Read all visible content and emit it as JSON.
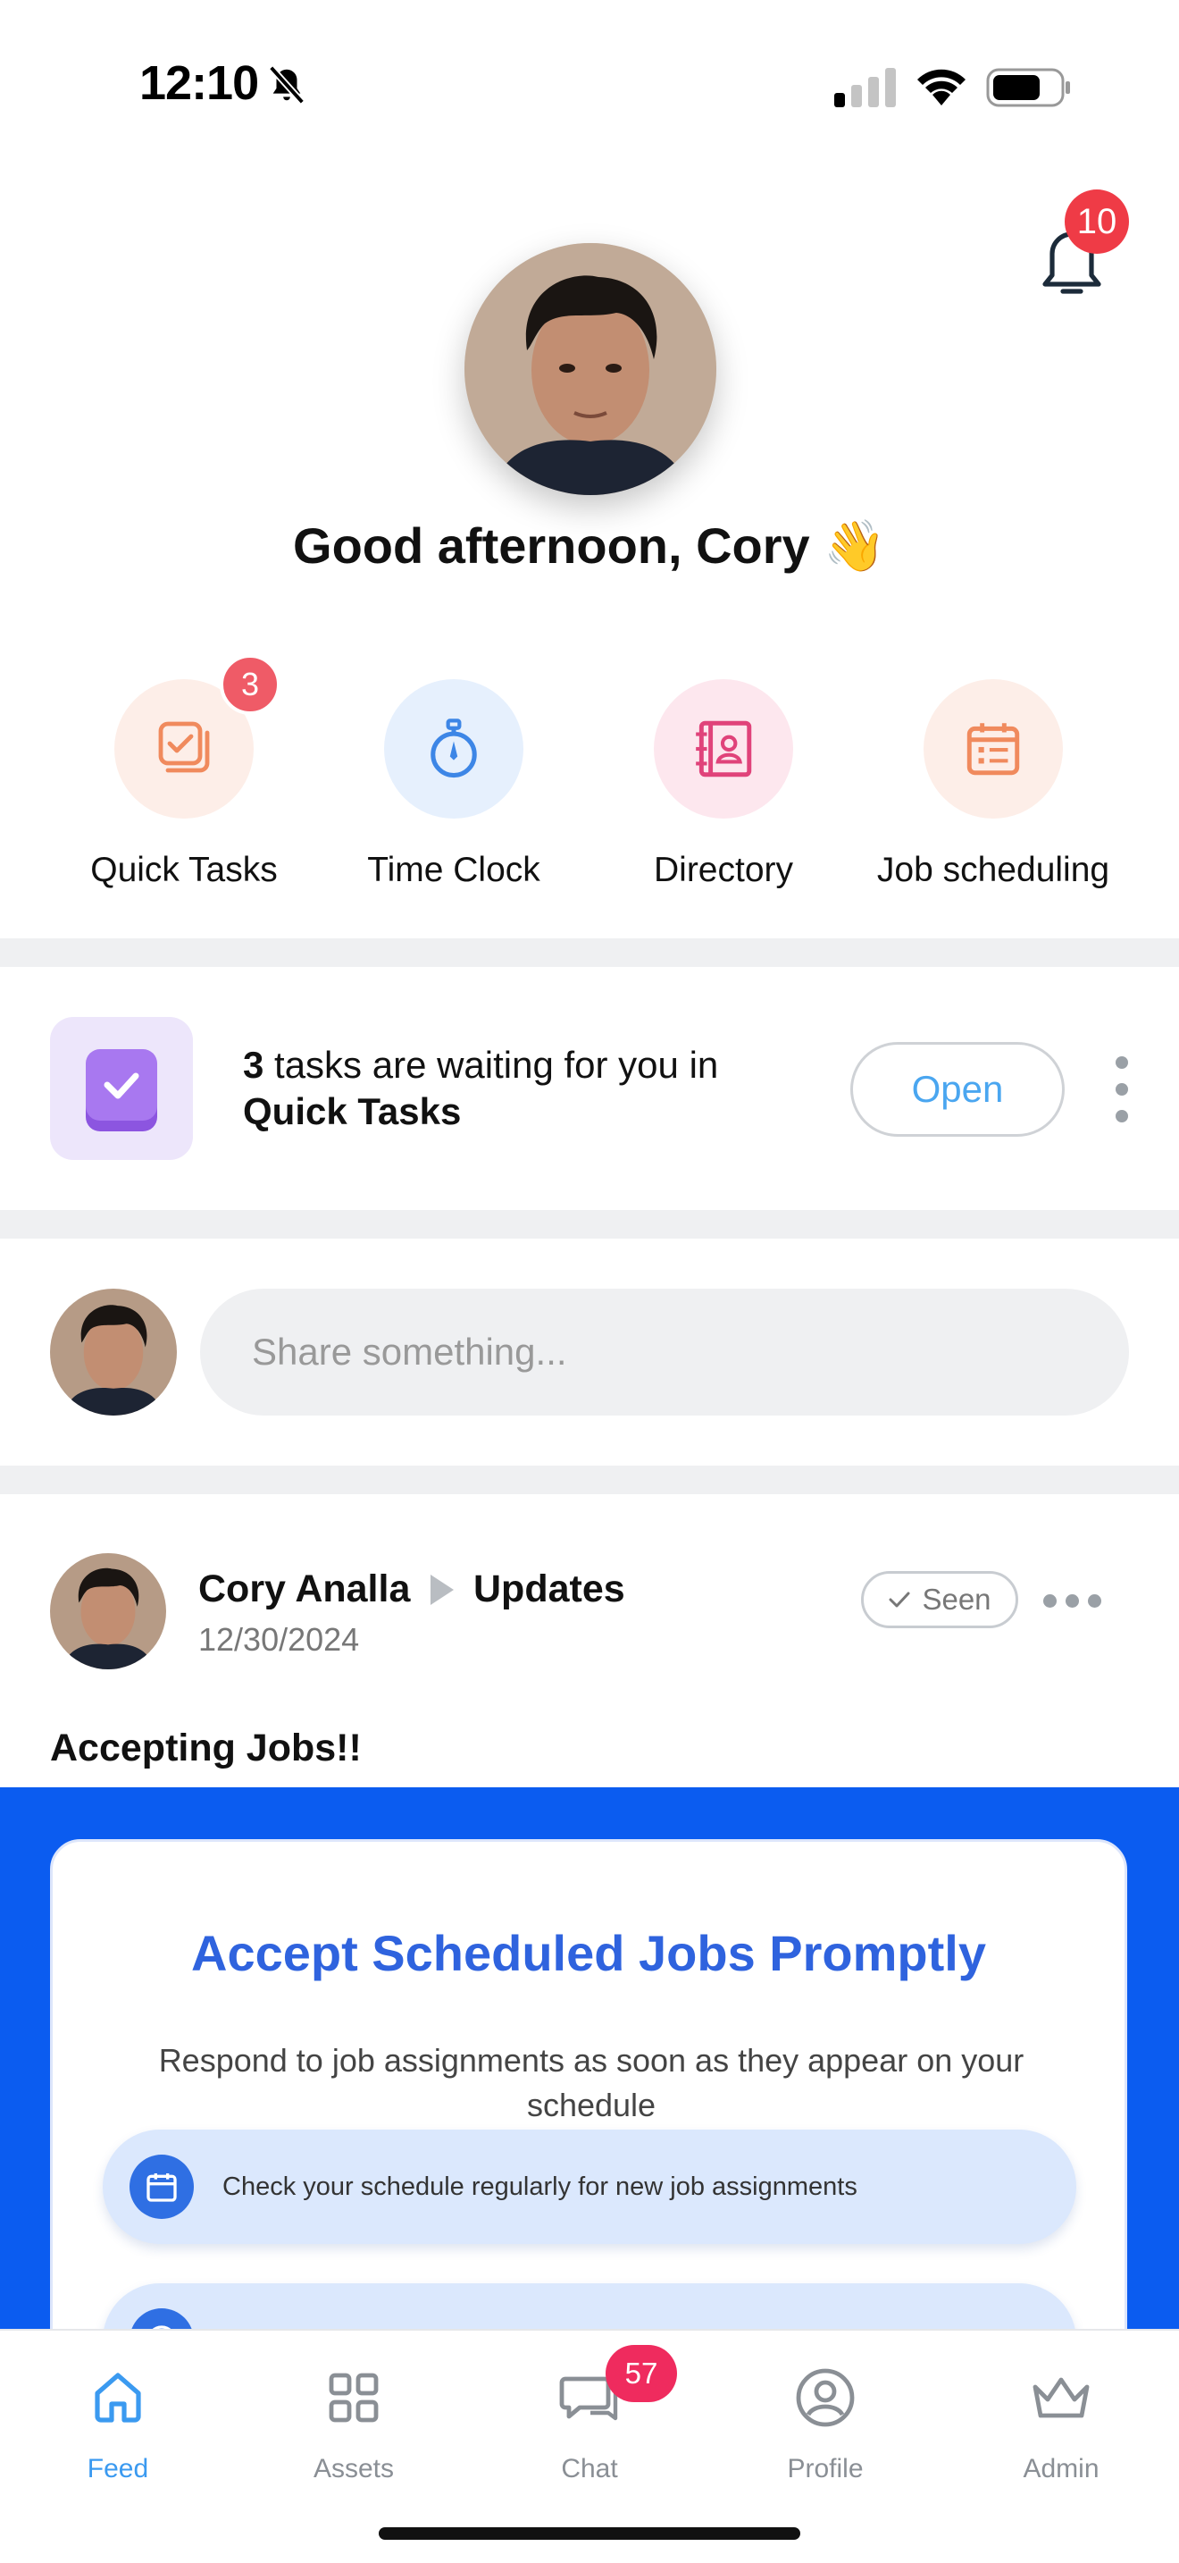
{
  "status_bar": {
    "time": "12:10"
  },
  "header": {
    "notification_count": "10",
    "greeting": "Good afternoon, Cory 👋"
  },
  "quick_actions": [
    {
      "label": "Quick Tasks",
      "badge": "3",
      "icon": "tasks-icon",
      "color": "#f08a5d"
    },
    {
      "label": "Time Clock",
      "icon": "stopwatch-icon",
      "color": "#3d86e6"
    },
    {
      "label": "Directory",
      "icon": "directory-icon",
      "color": "#e0437a"
    },
    {
      "label": "Job scheduling",
      "icon": "calendar-list-icon",
      "color": "#f08a5d"
    }
  ],
  "task_card": {
    "count": "3",
    "text_mid": " tasks are waiting for you in",
    "app_name": "Quick Tasks",
    "open_label": "Open"
  },
  "composer": {
    "placeholder": "Share something..."
  },
  "post": {
    "author": "Cory Analla",
    "channel": "Updates",
    "date": "12/30/2024",
    "seen_label": "Seen",
    "title": "Accepting Jobs!!",
    "image": {
      "headline": "Accept Scheduled Jobs Promptly",
      "subtext": "Respond to job assignments as soon as they appear on your schedule",
      "items": [
        {
          "text": "Check your schedule regularly for new job assignments",
          "icon": "calendar-icon"
        },
        {
          "text": "",
          "icon": "info-icon"
        }
      ]
    }
  },
  "tabbar": {
    "items": [
      {
        "label": "Feed",
        "icon": "home-icon",
        "active": true
      },
      {
        "label": "Assets",
        "icon": "grid-icon"
      },
      {
        "label": "Chat",
        "icon": "chat-icon",
        "badge": "57"
      },
      {
        "label": "Profile",
        "icon": "profile-icon"
      },
      {
        "label": "Admin",
        "icon": "crown-icon"
      }
    ]
  },
  "colors": {
    "accent": "#3b9af0",
    "badge_red": "#ef3b46",
    "post_image_blue": "#0b5cf0",
    "promo_title_blue": "#2f63de"
  }
}
